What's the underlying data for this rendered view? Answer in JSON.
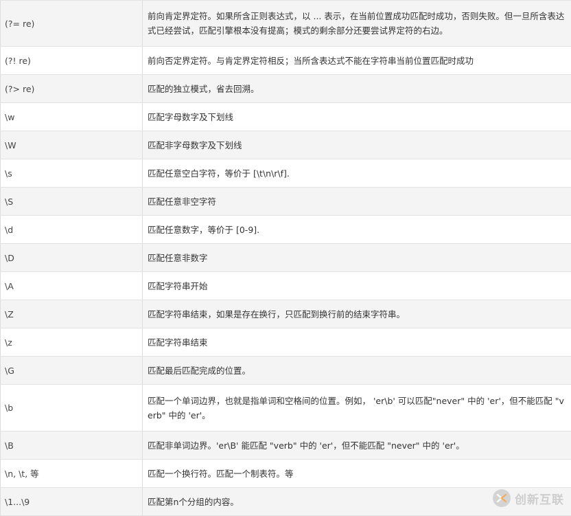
{
  "rows": [
    {
      "pattern": "(?= re)",
      "description": "前向肯定界定符。如果所含正则表达式，以 ... 表示，在当前位置成功匹配时成功，否则失败。但一旦所含表达式已经尝试，匹配引擎根本没有提高；模式的剩余部分还要尝试界定符的右边。"
    },
    {
      "pattern": "(?! re)",
      "description": "前向否定界定符。与肯定界定符相反；当所含表达式不能在字符串当前位置匹配时成功"
    },
    {
      "pattern": "(?> re)",
      "description": "匹配的独立模式，省去回溯。"
    },
    {
      "pattern": "\\w",
      "description": "匹配字母数字及下划线"
    },
    {
      "pattern": "\\W",
      "description": "匹配非字母数字及下划线"
    },
    {
      "pattern": "\\s",
      "description": "匹配任意空白字符，等价于 [\\t\\n\\r\\f]."
    },
    {
      "pattern": "\\S",
      "description": "匹配任意非空字符"
    },
    {
      "pattern": "\\d",
      "description": "匹配任意数字，等价于 [0-9]."
    },
    {
      "pattern": "\\D",
      "description": "匹配任意非数字"
    },
    {
      "pattern": "\\A",
      "description": "匹配字符串开始"
    },
    {
      "pattern": "\\Z",
      "description": "匹配字符串结束，如果是存在换行，只匹配到换行前的结束字符串。"
    },
    {
      "pattern": "\\z",
      "description": "匹配字符串结束"
    },
    {
      "pattern": "\\G",
      "description": "匹配最后匹配完成的位置。"
    },
    {
      "pattern": "\\b",
      "description": "匹配一个单词边界，也就是指单词和空格间的位置。例如， 'er\\b' 可以匹配\"never\" 中的 'er'，但不能匹配 \"verb\" 中的 'er'。"
    },
    {
      "pattern": "\\B",
      "description": "匹配非单词边界。'er\\B' 能匹配 \"verb\" 中的 'er'，但不能匹配 \"never\" 中的 'er'。"
    },
    {
      "pattern": "\\n, \\t, 等",
      "description": "匹配一个换行符。匹配一个制表符。等"
    },
    {
      "pattern": "\\1...\\9",
      "description": "匹配第n个分组的内容。"
    }
  ],
  "watermark": {
    "text": "创新互联",
    "icon": "chuangxin-logo-icon"
  }
}
